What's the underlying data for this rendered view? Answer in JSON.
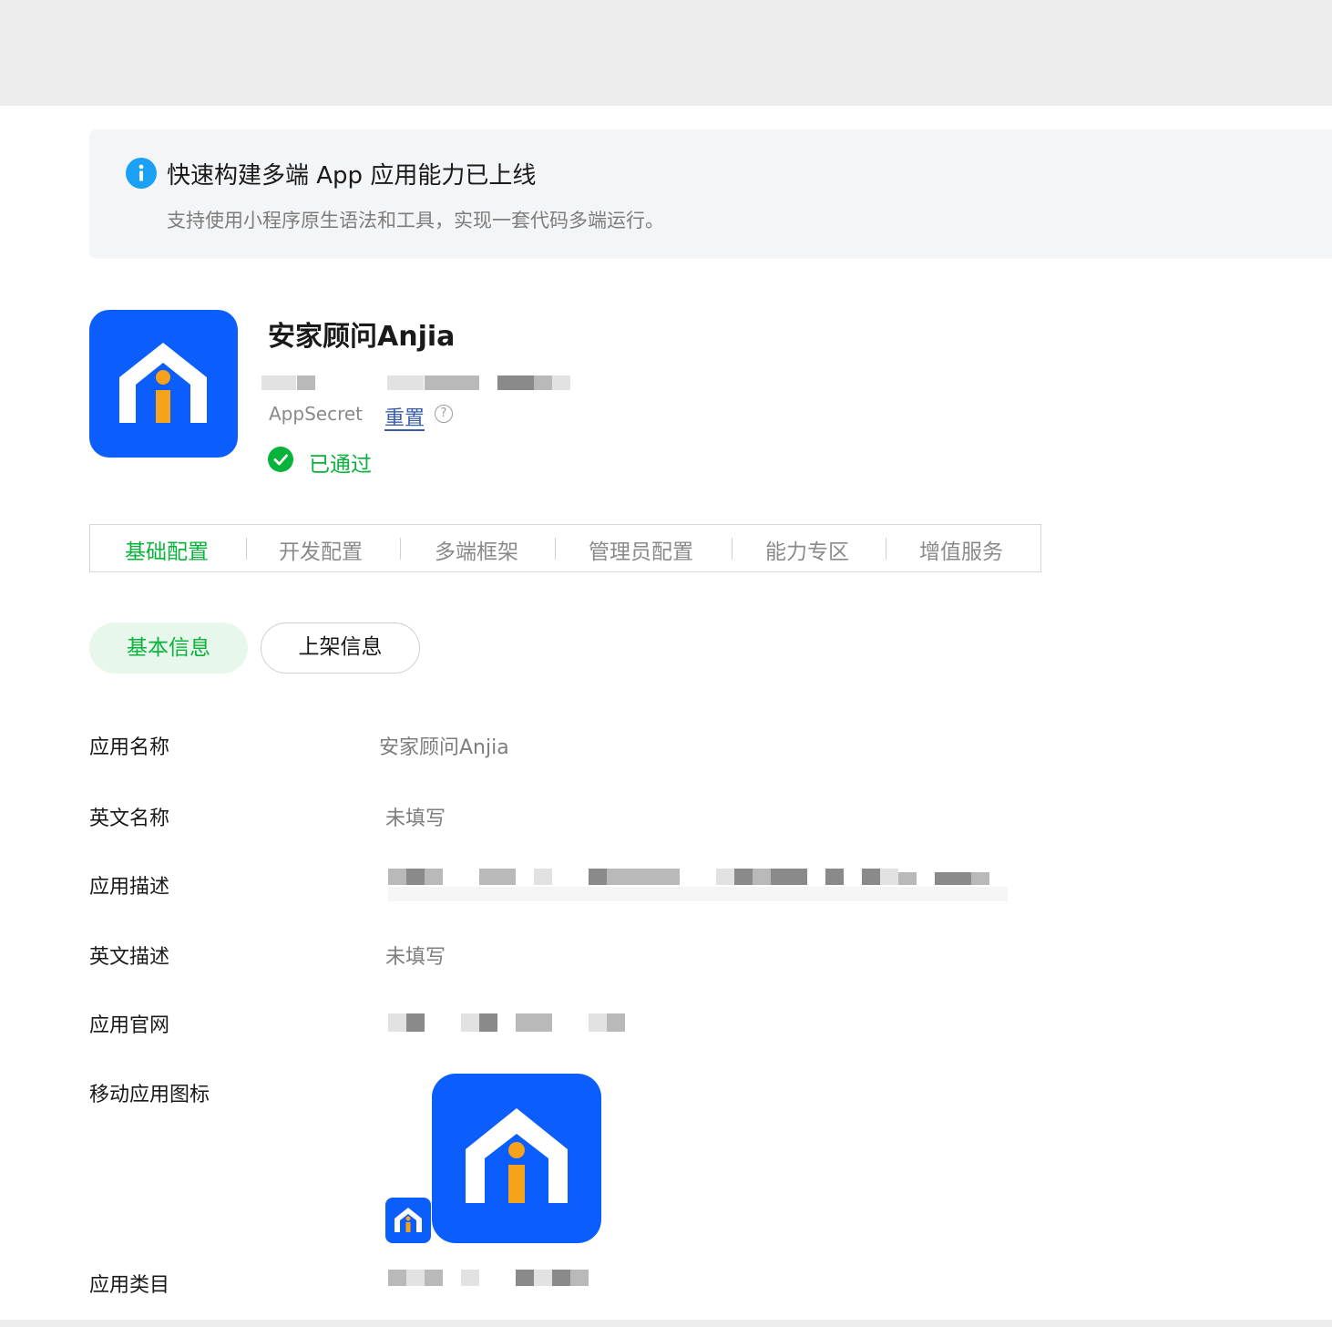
{
  "notice": {
    "title": "快速构建多端 App 应用能力已上线",
    "description": "支持使用小程序原生语法和工具，实现一套代码多端运行。"
  },
  "app": {
    "name": "安家顾问Anjia",
    "appsecret_label": "AppSecret",
    "reset_label": "重置",
    "help_symbol": "?",
    "status": "已通过"
  },
  "tabs": [
    "基础配置",
    "开发配置",
    "多端框架",
    "管理员配置",
    "能力专区",
    "增值服务"
  ],
  "subtabs": [
    "基本信息",
    "上架信息"
  ],
  "fields": [
    {
      "label": "应用名称",
      "value": "安家顾问Anjia"
    },
    {
      "label": "英文名称",
      "value": "未填写"
    },
    {
      "label": "应用描述",
      "value": ""
    },
    {
      "label": "英文描述",
      "value": "未填写"
    },
    {
      "label": "应用官网",
      "value": ""
    },
    {
      "label": "移动应用图标",
      "value": ""
    },
    {
      "label": "应用类目",
      "value": ""
    }
  ],
  "colors": {
    "accent_green": "#07b33a",
    "app_blue": "#0b5dfc",
    "info_blue": "#1aa1f5",
    "logo_orange": "#f5a31a",
    "link_blue": "#3a5ea8"
  },
  "icons": {
    "info": "info-icon",
    "status": "check-circle-icon",
    "help": "question-circle-icon"
  }
}
